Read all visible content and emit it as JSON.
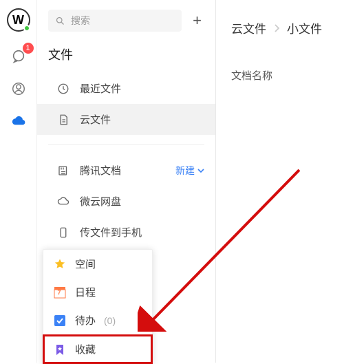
{
  "rail": {
    "avatar_text": "W",
    "msg_badge": "1"
  },
  "search": {
    "placeholder": "搜索"
  },
  "section_title": "文件",
  "items": {
    "recent": "最近文件",
    "cloud": "云文件",
    "tencent_docs": "腾讯文档",
    "tencent_new": "新建",
    "weiyun": "微云网盘",
    "send_to_phone": "传文件到手机"
  },
  "popup": {
    "space": "空间",
    "schedule": "日程",
    "schedule_day": "7",
    "todo": "待办",
    "todo_count": "(0)",
    "favorites": "收藏"
  },
  "breadcrumb": {
    "root": "云文件",
    "child": "小文件"
  },
  "column_header": "文档名称",
  "colors": {
    "accent_blue": "#3b82f6",
    "badge_red": "#ff4d4f",
    "highlight_red": "#d40d0d",
    "star_yellow": "#fbbf24",
    "cloud_blue": "#1a73e8",
    "bookmark_purple": "#7c5ce6"
  }
}
